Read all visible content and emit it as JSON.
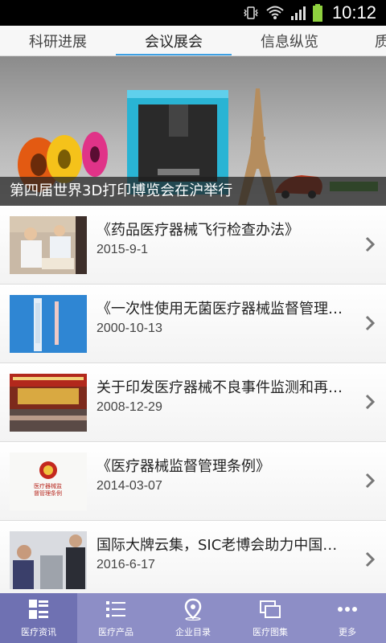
{
  "status_bar": {
    "time": "10:12"
  },
  "tabs": [
    {
      "label": "科研进展"
    },
    {
      "label": "会议展会"
    },
    {
      "label": "信息纵览"
    },
    {
      "label": "质"
    }
  ],
  "banner": {
    "caption": "第四届世界3D打印博览会在沪举行"
  },
  "news": [
    {
      "title": "《药品医疗器械飞行检查办法》",
      "date": "2015-9-1"
    },
    {
      "title": "《一次性使用无菌医疗器械监督管理…",
      "date": "2000-10-13"
    },
    {
      "title": "关于印发医疗器械不良事件监测和再…",
      "date": "2008-12-29"
    },
    {
      "title": "《医疗器械监督管理条例》",
      "date": "2014-03-07"
    },
    {
      "title": "国际大牌云集，SIC老博会助力中国…",
      "date": "2016-6-17"
    }
  ],
  "thumb4_text": "医疗器械监督管理条例",
  "bottom_nav": [
    {
      "label": "医疗资讯",
      "icon": "grid-list-icon"
    },
    {
      "label": "医疗产品",
      "icon": "list-icon"
    },
    {
      "label": "企业目录",
      "icon": "location-pin-icon"
    },
    {
      "label": "医疗图集",
      "icon": "gallery-icon"
    },
    {
      "label": "更多",
      "icon": "more-dots-icon"
    }
  ],
  "colors": {
    "tab_accent": "#3ea1e4",
    "nav_bg": "#8d8ec6",
    "nav_active": "#6f71b2"
  }
}
